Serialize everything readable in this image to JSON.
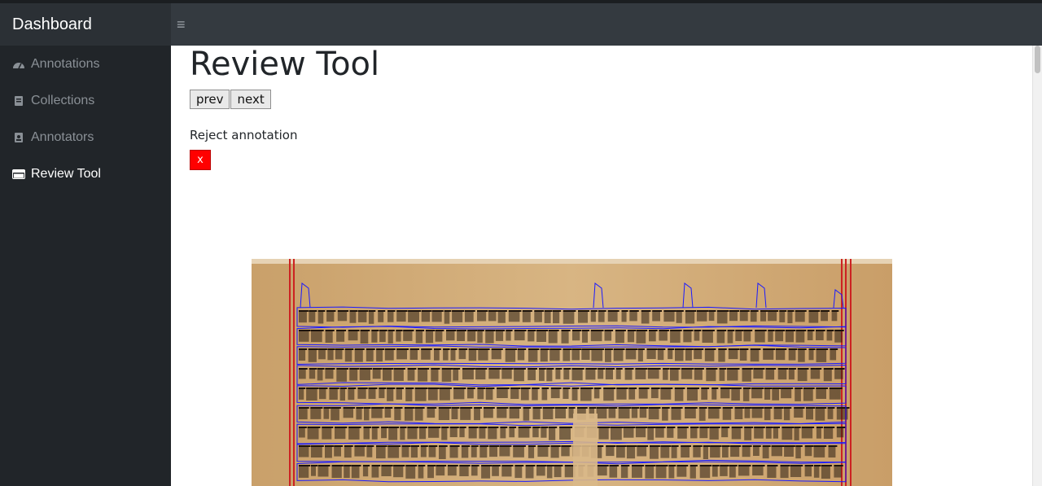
{
  "navbar": {
    "brand": "Dashboard",
    "menu_icon": "hamburger-icon",
    "menu_glyph": "≡"
  },
  "sidebar": {
    "items": [
      {
        "label": "Annotations",
        "icon": "tachometer-icon",
        "active": false
      },
      {
        "label": "Collections",
        "icon": "book-icon",
        "active": false
      },
      {
        "label": "Annotators",
        "icon": "address-book-icon",
        "active": false
      },
      {
        "label": "Review Tool",
        "icon": "window-icon",
        "active": true
      }
    ]
  },
  "main": {
    "title": "Review Tool",
    "prev_label": "prev",
    "next_label": "next",
    "reject_label": "Reject annotation",
    "reject_button": "x"
  },
  "colors": {
    "navbar": "#343a40",
    "sidebar": "#212529",
    "reject": "#ff0000",
    "annotation_box": "#1a1aff",
    "page_border": "#cc2222"
  }
}
